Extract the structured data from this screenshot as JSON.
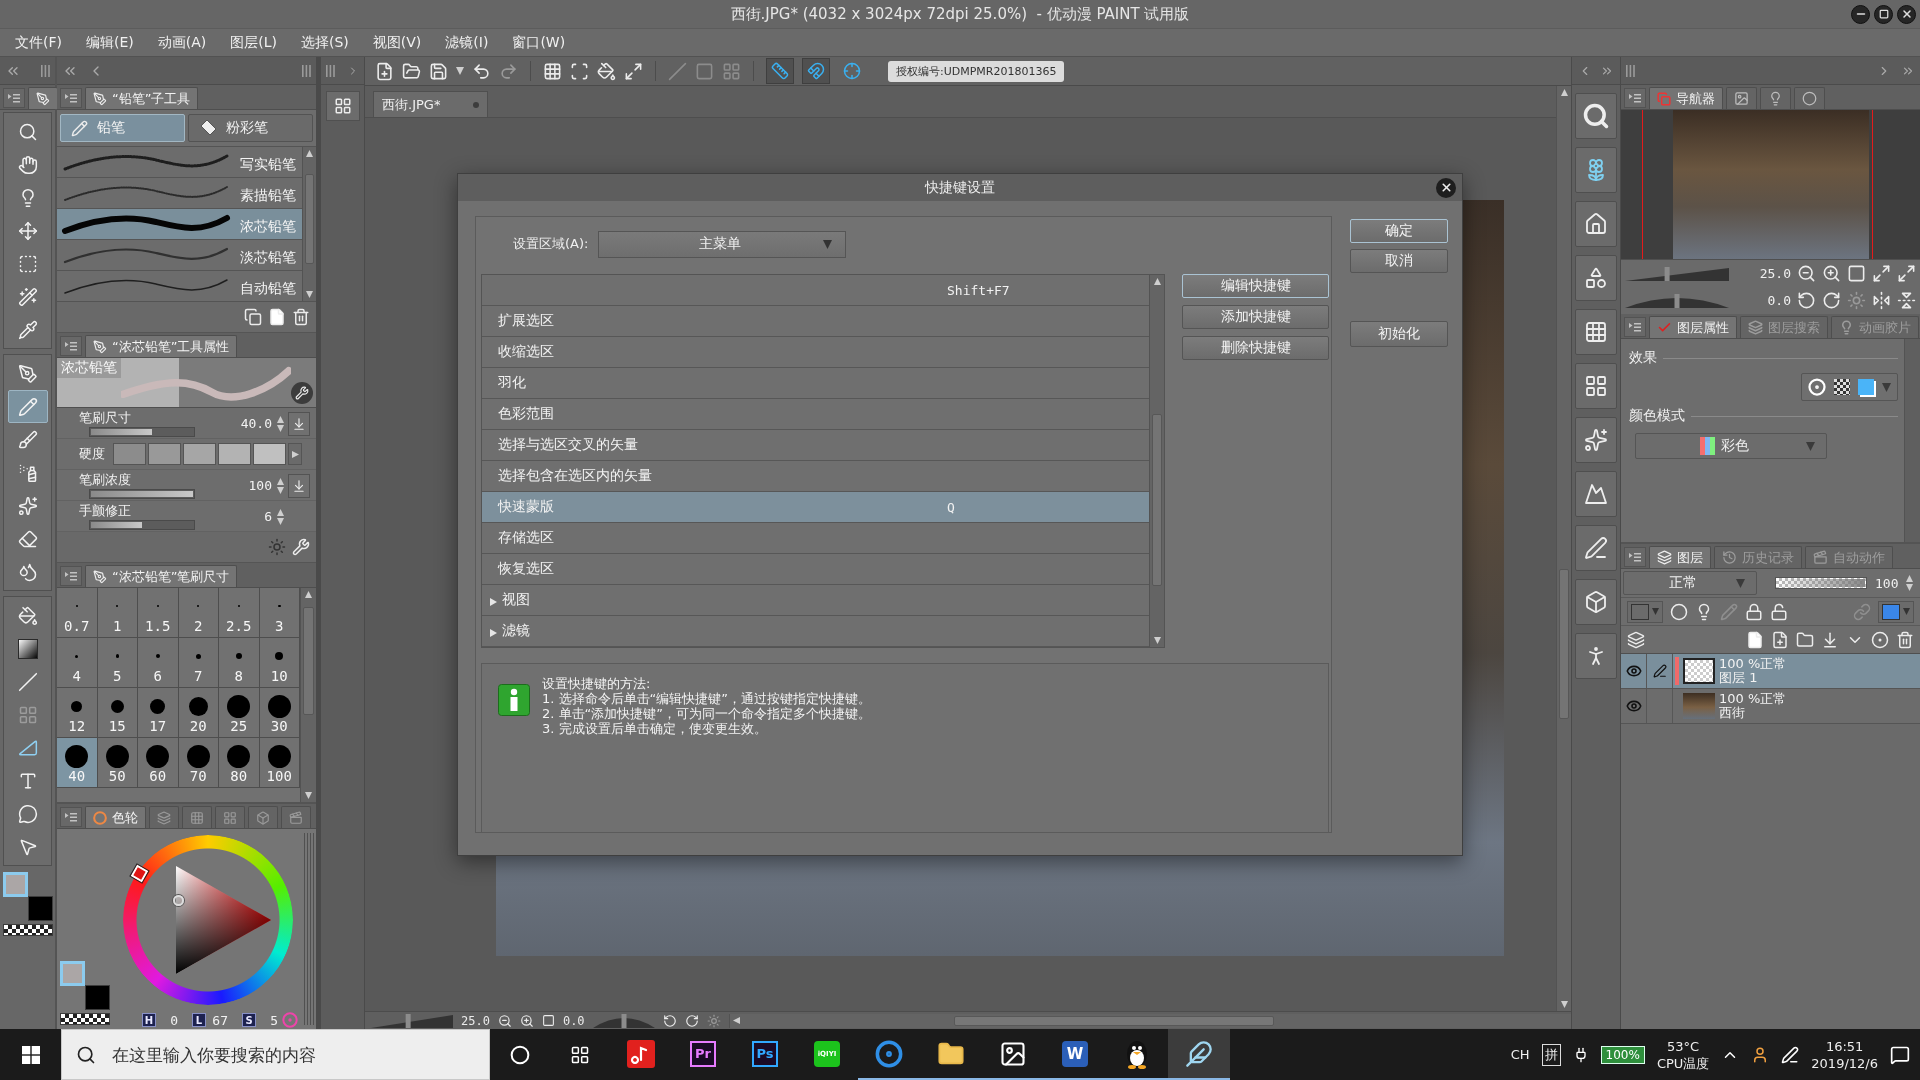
{
  "window": {
    "title": "西街.JPG* (4032 x 3024px 72dpi 25.0%)  - 优动漫 PAINT 试用版"
  },
  "menu": [
    "文件(F)",
    "编辑(E)",
    "动画(A)",
    "图层(L)",
    "选择(S)",
    "视图(V)",
    "滤镜(I)",
    "窗口(W)"
  ],
  "toolbar": {
    "snap_toggles": [
      {
        "on": true
      },
      {
        "on": true
      },
      {
        "on": false
      }
    ],
    "license": "授权编号:UDMPMR201801365"
  },
  "tool_groups": [
    {
      "tools": [
        {
          "selected": false,
          "disabled": false
        },
        {
          "selected": false,
          "disabled": false
        },
        {
          "selected": false,
          "disabled": false
        },
        {
          "selected": false,
          "disabled": false
        },
        {
          "selected": false,
          "disabled": false
        },
        {
          "selected": false,
          "disabled": false
        },
        {
          "selected": false,
          "disabled": false
        }
      ]
    },
    {
      "tools": [
        {
          "selected": false,
          "disabled": false
        },
        {
          "selected": true,
          "disabled": false
        },
        {
          "selected": false,
          "disabled": false
        },
        {
          "selected": false,
          "disabled": false
        },
        {
          "selected": false,
          "disabled": false
        },
        {
          "selected": false,
          "disabled": false
        },
        {
          "selected": false,
          "disabled": false
        }
      ]
    },
    {
      "tools": [
        {
          "selected": false,
          "disabled": false
        },
        {
          "selected": false,
          "disabled": false
        },
        {
          "selected": false,
          "disabled": false
        },
        {
          "selected": false,
          "disabled": true
        },
        {
          "selected": false,
          "disabled": false
        },
        {
          "selected": false,
          "disabled": false
        },
        {
          "selected": false,
          "disabled": false
        },
        {
          "selected": false,
          "disabled": false
        }
      ]
    }
  ],
  "tool_colors": [
    {
      "color": "#aba6a6",
      "selected": true
    },
    {
      "color": "#000000",
      "selected": false
    }
  ],
  "subtools": {
    "title": "“铅笔”子工具",
    "groups": [
      {
        "label": "铅笔",
        "selected": true
      },
      {
        "label": "粉彩笔",
        "selected": false
      }
    ],
    "brushes": [
      {
        "label": "写实铅笔",
        "selected": false
      },
      {
        "label": "素描铅笔",
        "selected": false
      },
      {
        "label": "浓芯铅笔",
        "selected": true
      },
      {
        "label": "淡芯铅笔",
        "selected": false
      },
      {
        "label": "自动铅笔",
        "selected": false
      }
    ]
  },
  "tool_property": {
    "title": "“浓芯铅笔”工具属性",
    "preview_label": "浓芯铅笔",
    "settings": [
      {
        "kind": "slider",
        "label": "笔刷尺寸",
        "value": "40.0",
        "level": 0.6,
        "pressure": true
      },
      {
        "kind": "swatches",
        "label": "硬度"
      },
      {
        "kind": "slider",
        "label": "笔刷浓度",
        "value": "100",
        "level": 1,
        "pressure": true
      },
      {
        "kind": "slider",
        "label": "手颤修正",
        "value": "6",
        "level": 0.5,
        "pressure": false
      }
    ]
  },
  "brush_size": {
    "title": "“浓芯铅笔”笔刷尺寸",
    "sizes": [
      {
        "label": "0.7",
        "selected": false
      },
      {
        "label": "1",
        "selected": false
      },
      {
        "label": "1.5",
        "selected": false
      },
      {
        "label": "2",
        "selected": false
      },
      {
        "label": "2.5",
        "selected": false
      },
      {
        "label": "3",
        "selected": false
      },
      {
        "label": "4",
        "selected": false
      },
      {
        "label": "5",
        "selected": false
      },
      {
        "label": "6",
        "selected": false
      },
      {
        "label": "7",
        "selected": false
      },
      {
        "label": "8",
        "selected": false
      },
      {
        "label": "10",
        "selected": false
      },
      {
        "label": "12",
        "selected": false
      },
      {
        "label": "15",
        "selected": false
      },
      {
        "label": "17",
        "selected": false
      },
      {
        "label": "20",
        "selected": false
      },
      {
        "label": "25",
        "selected": false
      },
      {
        "label": "30",
        "selected": false
      },
      {
        "label": "40",
        "selected": true
      },
      {
        "label": "50",
        "selected": false
      },
      {
        "label": "60",
        "selected": false
      },
      {
        "label": "70",
        "selected": false
      },
      {
        "label": "80",
        "selected": false
      },
      {
        "label": "100",
        "selected": false
      }
    ]
  },
  "color_wheel": {
    "tabs": [
      {
        "label": "色轮",
        "selected": true
      },
      {
        "selected": false
      },
      {
        "selected": false
      },
      {
        "selected": false
      },
      {
        "selected": false
      },
      {
        "selected": false
      }
    ],
    "colors": [
      {
        "color": "#aba6a6",
        "selected": true
      },
      {
        "color": "#000000",
        "selected": false
      }
    ],
    "readouts": [
      {
        "label": "H",
        "value": "0"
      },
      {
        "label": "L",
        "value": "67"
      },
      {
        "label": "S",
        "value": "5"
      }
    ]
  },
  "document": {
    "tab": "西街.JPG*",
    "zoom_slider": {
      "level": 0.45
    },
    "zoom": "25.0",
    "angle": "0.0",
    "angle_slider": {
      "level": 0.5
    }
  },
  "dialog": {
    "title": "快捷键设置",
    "area_label": "设置区域(A):",
    "area_value": "主菜单",
    "commands": [
      {
        "kind": "command",
        "shortcut": "Shift+F7",
        "selected": false
      },
      {
        "kind": "command",
        "name": "扩展选区",
        "selected": false
      },
      {
        "kind": "command",
        "name": "收缩选区",
        "selected": false
      },
      {
        "kind": "command",
        "name": "羽化",
        "selected": false
      },
      {
        "kind": "command",
        "name": "色彩范围",
        "selected": false
      },
      {
        "kind": "command",
        "name": "选择与选区交叉的矢量",
        "selected": false
      },
      {
        "kind": "command",
        "name": "选择包含在选区内的矢量",
        "selected": false
      },
      {
        "kind": "command",
        "name": "快速蒙版",
        "shortcut": "Q",
        "selected": true
      },
      {
        "kind": "command",
        "name": "存储选区",
        "selected": false
      },
      {
        "kind": "command",
        "name": "恢复选区",
        "selected": false
      },
      {
        "kind": "group",
        "name": "视图",
        "expanded": false,
        "selected": false
      },
      {
        "kind": "group",
        "name": "滤镜",
        "expanded": false,
        "selected": false
      }
    ],
    "actions": [
      {
        "label": "编辑快捷键",
        "focused": true
      },
      {
        "label": "添加快捷键",
        "focused": false
      },
      {
        "label": "删除快捷键",
        "focused": false
      }
    ],
    "confirm": [
      {
        "label": "确定",
        "focused": true
      },
      {
        "label": "取消",
        "focused": false
      }
    ],
    "reset": {
      "label": "初始化"
    },
    "help": {
      "title": "设置快捷键的方法:",
      "steps": [
        "1. 选择命令后单击“编辑快捷键”，通过按键指定快捷键。",
        "2. 单击“添加快捷键”，可为同一个命令指定多个快捷键。",
        "3. 完成设置后单击确定，使变更生效。"
      ]
    }
  },
  "navigator": {
    "tabs": [
      {
        "label": "导航器",
        "selected": true
      },
      {
        "selected": false
      },
      {
        "selected": false
      },
      {
        "selected": false
      }
    ],
    "zoom_slider": {
      "level": 0.4
    },
    "zoom": "25.0",
    "angle_slider": {
      "level": 0.5
    },
    "angle": "0.0"
  },
  "layer_property": {
    "tabs": [
      {
        "label": "图层属性",
        "selected": true
      },
      {
        "label": "图层搜索",
        "selected": false
      },
      {
        "label": "动画胶片",
        "selected": false
      }
    ],
    "effect_label": "效果",
    "color_mode_label": "颜色模式",
    "color_mode": "彩色"
  },
  "layers": {
    "tabs": [
      {
        "label": "图层",
        "selected": true
      },
      {
        "label": "历史记录",
        "selected": false
      },
      {
        "label": "自动动作",
        "selected": false
      }
    ],
    "blend_mode": "正常",
    "opacity": {
      "value": "100",
      "level": 1
    },
    "items": [
      {
        "kind": "blank",
        "mode": "100 %正常",
        "name": "图层 1",
        "selected": true,
        "editing": true
      },
      {
        "kind": "photo",
        "mode": "100 %正常",
        "name": "西街",
        "selected": false,
        "editing": false
      }
    ]
  },
  "taskbar": {
    "search": {
      "placeholder": "在这里输入你要搜索的内容"
    },
    "apps": [
      {
        "kind": "music",
        "running": false,
        "selected": false
      },
      {
        "kind": "outlined-tile",
        "label": "Pr",
        "color": "#e77bff",
        "running": false,
        "selected": false
      },
      {
        "kind": "outlined-tile",
        "label": "Ps",
        "color": "#31a8ff",
        "running": false,
        "selected": false
      },
      {
        "kind": "filled-tile",
        "label": "iQIYI",
        "color": "#1cc31c",
        "running": false,
        "selected": false
      },
      {
        "kind": "browser",
        "running": true,
        "selected": false
      },
      {
        "kind": "folder",
        "running": true,
        "selected": false
      },
      {
        "kind": "picture",
        "running": true,
        "selected": false
      },
      {
        "kind": "filled-tile",
        "label": "W",
        "color": "#2b5fb8",
        "running": true,
        "selected": false
      },
      {
        "kind": "penguin",
        "running": true,
        "selected": false
      },
      {
        "kind": "feather",
        "running": true,
        "selected": true
      }
    ],
    "ime": "CH",
    "ime_mode": "拼",
    "battery": "100%",
    "temperature": "53°C",
    "temperature_label": "CPU温度",
    "time": "16:51",
    "date": "2019/12/6"
  }
}
